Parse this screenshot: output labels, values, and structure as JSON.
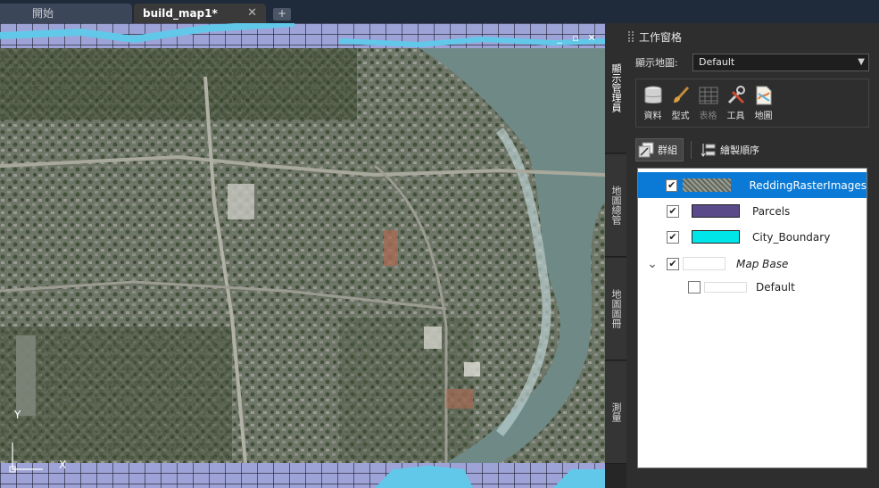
{
  "tabs": [
    {
      "label": "開始"
    },
    {
      "label": "build_map1*"
    }
  ],
  "tab_close_glyph": "✕",
  "tab_add_glyph": "+",
  "viewport_controls": {
    "minimize": "_",
    "restore": "▫",
    "close": "✕"
  },
  "map": {
    "axis": {
      "y_label": "Y",
      "x_label": "X"
    }
  },
  "panel": {
    "title": "工作窗格",
    "vertical_tabs": [
      {
        "label": "顯示管理員",
        "active": true
      },
      {
        "label": "地圖總管",
        "active": false
      },
      {
        "label": "地圖圖冊",
        "active": false
      },
      {
        "label": "測量",
        "active": false
      }
    ],
    "map_selector": {
      "label": "顯示地圖:",
      "value": "Default"
    },
    "tools": [
      {
        "label": "資料",
        "icon": "data-icon",
        "enabled": true
      },
      {
        "label": "型式",
        "icon": "style-icon",
        "enabled": true
      },
      {
        "label": "表格",
        "icon": "table-icon",
        "enabled": false
      },
      {
        "label": "工具",
        "icon": "tools-icon",
        "enabled": true
      },
      {
        "label": "地圖",
        "icon": "map-icon",
        "enabled": true
      }
    ],
    "modes": [
      {
        "label": "群組",
        "icon": "group-icon",
        "active": true
      },
      {
        "label": "繪製順序",
        "icon": "draw-order-icon",
        "active": false
      }
    ],
    "layers": [
      {
        "name": "ReddingRasterImages",
        "checked": true,
        "selected": true,
        "swatch": "raster",
        "italic": false
      },
      {
        "name": "Parcels",
        "checked": true,
        "selected": false,
        "swatch": "#5a4a8a",
        "italic": false
      },
      {
        "name": "City_Boundary",
        "checked": true,
        "selected": false,
        "swatch": "#00e5e8",
        "italic": false
      },
      {
        "name": "Map Base",
        "checked": true,
        "selected": false,
        "swatch": "#ffffff",
        "italic": true,
        "expanded": true
      },
      {
        "name": "Default",
        "checked": false,
        "selected": false,
        "swatch": "#ffffff",
        "italic": false
      }
    ]
  },
  "colors": {
    "accent": "#0a7ad6",
    "parcel_fill": "#9da3d6",
    "boundary": "#62c8ea"
  }
}
